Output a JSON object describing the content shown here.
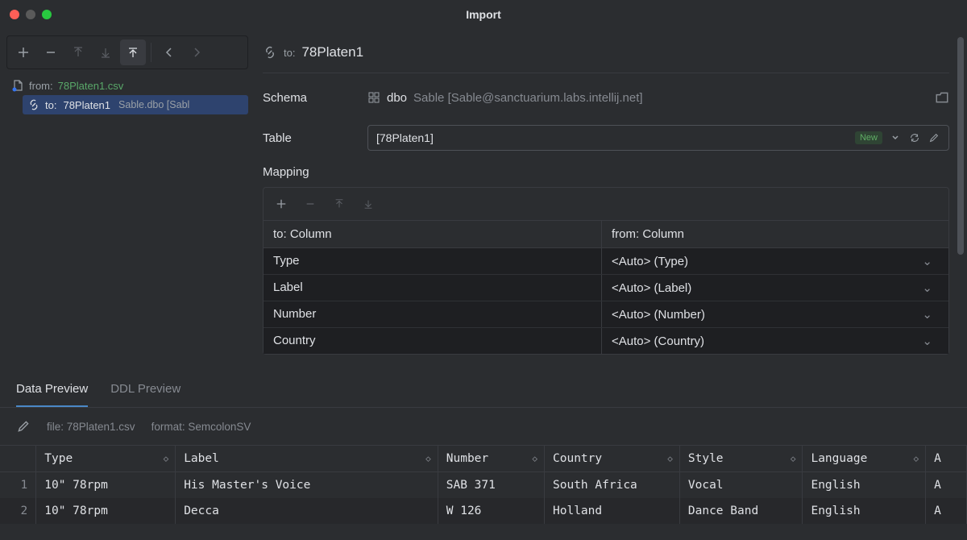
{
  "window": {
    "title": "Import"
  },
  "toolbar": {
    "add": "+",
    "remove": "−",
    "moveUp": "↑",
    "moveDown": "↓",
    "upOne": "⇡",
    "back": "←",
    "forward": "→"
  },
  "source": {
    "fromLabel": "from:",
    "fileName": "78Platen1.csv"
  },
  "target": {
    "toLabel": "to:",
    "name": "78Platen1",
    "meta": "Sable.dbo [Sabl"
  },
  "form": {
    "schemaLabel": "Schema",
    "schemaName": "dbo",
    "schemaPath": "Sable [Sable@sanctuarium.labs.intellij.net]",
    "tableLabel": "Table",
    "tableValue": "[78Platen1]",
    "newBadge": "New",
    "mappingLabel": "Mapping",
    "mapHeaderTo": "to: Column",
    "mapHeaderFrom": "from: Column",
    "mapping": [
      {
        "to": "Type",
        "from": "<Auto> (Type)"
      },
      {
        "to": "Label",
        "from": "<Auto> (Label)"
      },
      {
        "to": "Number",
        "from": "<Auto> (Number)"
      },
      {
        "to": "Country",
        "from": "<Auto> (Country)"
      }
    ]
  },
  "tabs": {
    "dataPreview": "Data Preview",
    "ddlPreview": "DDL Preview"
  },
  "preview": {
    "fileInfo": "file: 78Platen1.csv",
    "formatInfo": "format: SemcolonSV",
    "columns": [
      "Type",
      "Label",
      "Number",
      "Country",
      "Style",
      "Language",
      "A"
    ],
    "rows": [
      {
        "n": "1",
        "Type": "10\" 78rpm",
        "Label": "His Master's Voice",
        "Number": "SAB 371",
        "Country": "South Africa",
        "Style": "Vocal",
        "Language": "English",
        "A": "A"
      },
      {
        "n": "2",
        "Type": "10\" 78rpm",
        "Label": "Decca",
        "Number": "W 126",
        "Country": "Holland",
        "Style": "Dance Band",
        "Language": "English",
        "A": "A"
      }
    ]
  }
}
